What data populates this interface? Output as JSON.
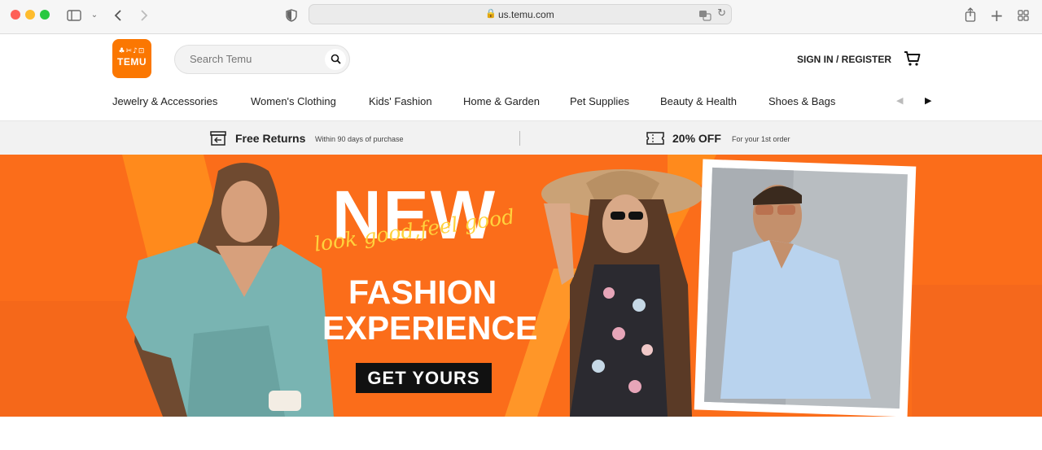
{
  "browser": {
    "url": "us.temu.com",
    "icons": [
      "sidebar-icon",
      "chevron-down-icon",
      "back-icon",
      "forward-icon",
      "shield-icon",
      "lock-icon",
      "translate-icon",
      "reload-icon",
      "share-icon",
      "new-tab-icon",
      "tab-overview-icon"
    ]
  },
  "header": {
    "logo_text": "TEMU",
    "search_placeholder": "Search Temu",
    "signin_label": "SIGN IN / REGISTER",
    "brand_color": "#fb7701"
  },
  "categories": [
    "Jewelry & Accessories",
    "Women's Clothing",
    "Kids' Fashion",
    "Home & Garden",
    "Pet Supplies",
    "Beauty & Health",
    "Shoes & Bags"
  ],
  "promos": {
    "returns_title": "Free Returns",
    "returns_sub": "Within 90 days of purchase",
    "discount_title": "20% OFF",
    "discount_sub": "For your 1st order"
  },
  "hero": {
    "headline": "NEW",
    "tagline": "look good,feel good",
    "line1": "FASHION",
    "line2": "EXPERIENCE",
    "cta": "GET YOURS",
    "bg_color": "#fb6d1a",
    "accent_color": "#ffd23c"
  }
}
